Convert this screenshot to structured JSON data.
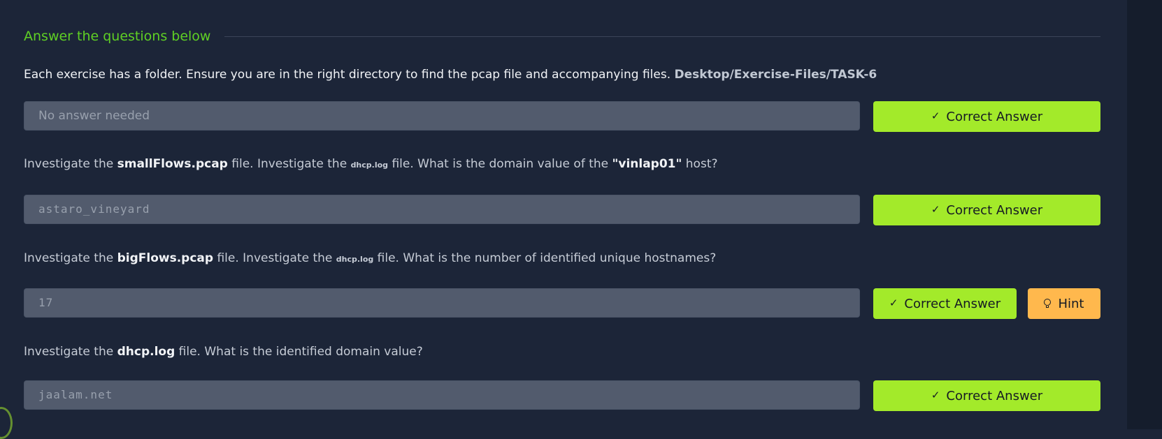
{
  "section": {
    "title": "Answer the questions below"
  },
  "questions": [
    {
      "text_before": "Each exercise has a folder. Ensure you are in the right directory to find the pcap file and accompanying files.",
      "path": "Desktop/Exercise-Files/TASK-6",
      "answer": "No answer needed",
      "submit_label": "Correct Answer"
    },
    {
      "part1": "Investigate the",
      "file1": "smallFlows.pcap",
      "part2": "file. Investigate the",
      "file2": "dhcp.log",
      "part3": "file. What is the domain value of the",
      "host": "\"vinlap01\"",
      "part4": "host?",
      "answer": "astaro_vineyard",
      "submit_label": "Correct Answer"
    },
    {
      "part1": "Investigate the",
      "file1": "bigFlows.pcap",
      "part2": "file. Investigate the",
      "file2": "dhcp.log",
      "part3": "file. What is the number of identified unique hostnames?",
      "answer": "17",
      "submit_label": "Correct Answer",
      "hint_label": "Hint"
    },
    {
      "part1": "Investigate the",
      "file1": "dhcp.log",
      "part2": "file. What is the identified domain value?",
      "answer": "jaalam.net",
      "submit_label": "Correct Answer"
    }
  ],
  "icons": {
    "check": "check-icon",
    "hint": "lightbulb-icon"
  },
  "colors": {
    "background": "#1c2538",
    "accent_green": "#a3ea2a",
    "title_green": "#5fd024",
    "hint_orange": "#ffb84d"
  }
}
